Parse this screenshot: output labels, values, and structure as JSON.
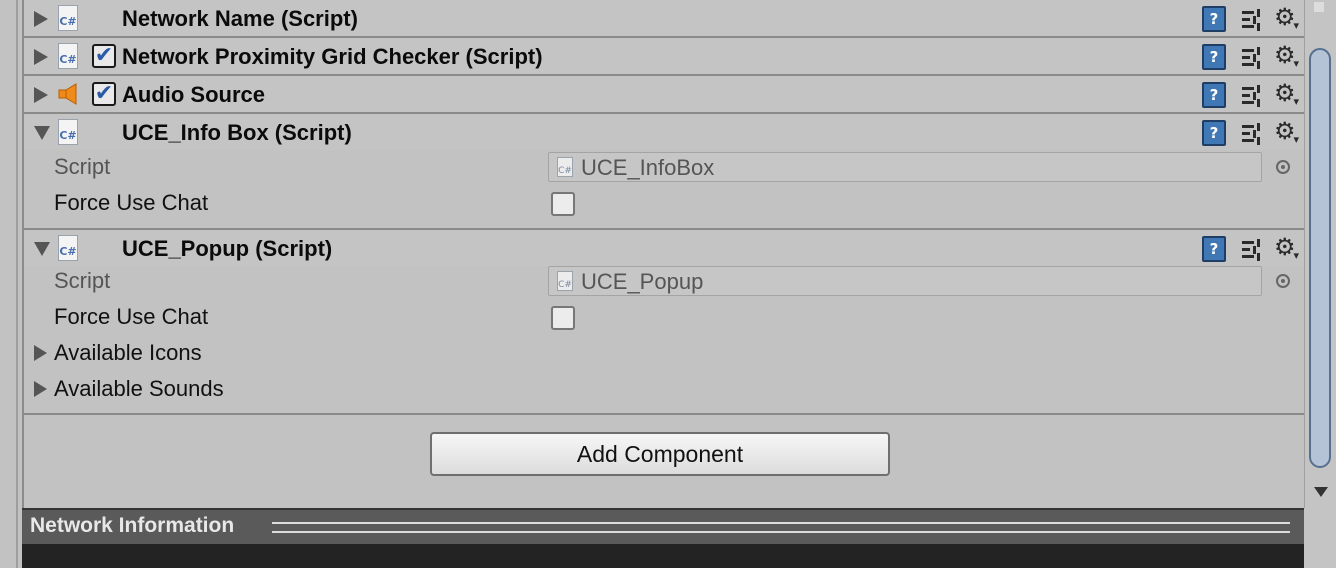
{
  "components": [
    {
      "title": "Network Name (Script)",
      "expanded": false,
      "icon": "csharp-script-icon",
      "has_checkbox": false
    },
    {
      "title": "Network Proximity Grid Checker (Script)",
      "expanded": false,
      "icon": "csharp-script-icon",
      "has_checkbox": true,
      "enabled": true
    },
    {
      "title": "Audio Source",
      "expanded": false,
      "icon": "speaker-icon",
      "has_checkbox": true,
      "enabled": true
    },
    {
      "title": "UCE_Info Box (Script)",
      "expanded": true,
      "icon": "csharp-script-icon",
      "has_checkbox": false,
      "properties": [
        {
          "label": "Script",
          "value": "UCE_InfoBox",
          "type": "object-field"
        },
        {
          "label": "Force Use Chat",
          "value": false,
          "type": "toggle"
        }
      ]
    },
    {
      "title": "UCE_Popup (Script)",
      "expanded": true,
      "icon": "csharp-script-icon",
      "has_checkbox": false,
      "properties": [
        {
          "label": "Script",
          "value": "UCE_Popup",
          "type": "object-field"
        },
        {
          "label": "Force Use Chat",
          "value": false,
          "type": "toggle"
        },
        {
          "label": "Available Icons",
          "type": "foldout",
          "expanded": false
        },
        {
          "label": "Available Sounds",
          "type": "foldout",
          "expanded": false
        }
      ]
    }
  ],
  "icons": {
    "cs_glyph": "C#",
    "help_glyph": "?",
    "gear_glyph": "⚙",
    "dropdown_glyph": "▾",
    "check_glyph": "✔"
  },
  "add_component_label": "Add Component",
  "network_panel": {
    "title": "Network Information"
  },
  "colors": {
    "background": "#c2c2c2",
    "accent": "#3f78b4",
    "dark_panel": "#232323"
  }
}
